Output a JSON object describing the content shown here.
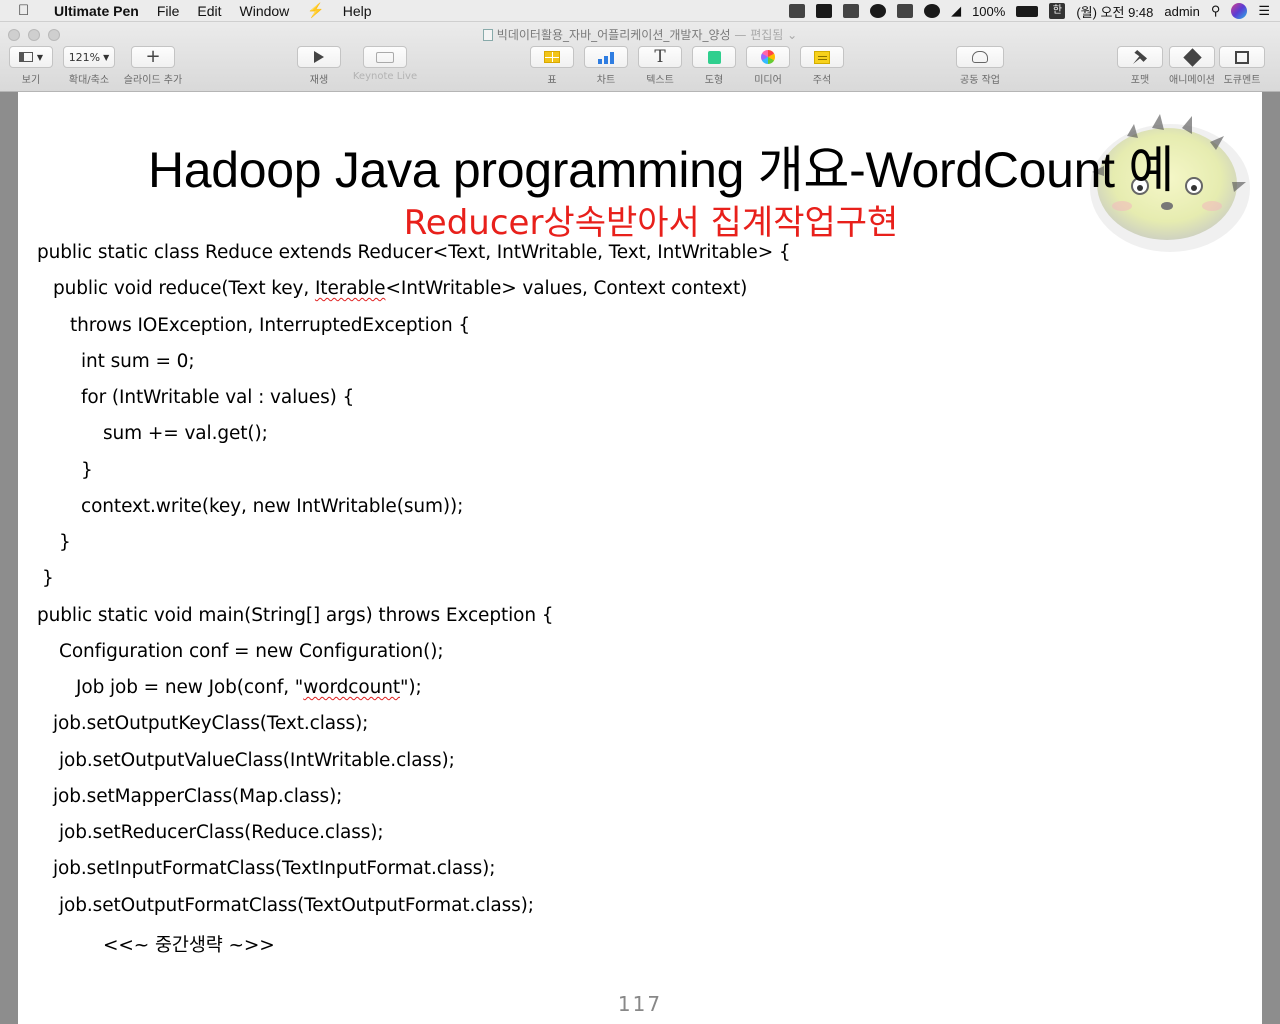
{
  "menubar": {
    "app_name": "Ultimate Pen",
    "menus": [
      "File",
      "Edit",
      "Window",
      "Help"
    ],
    "battery": "100%",
    "ime": "한",
    "clock": "(월) 오전 9:48",
    "user": "admin"
  },
  "window": {
    "title": "빅데이터활용_자바_어플리케이션_개발자_양성",
    "title_suffix": "— 편집됨 ⌄"
  },
  "toolbar": {
    "view_label": "보기",
    "zoom_value": "121%",
    "zoom_label": "확대/축소",
    "add_slide_label": "슬라이드 추가",
    "play_label": "재생",
    "keynote_live_label": "Keynote Live",
    "table_label": "표",
    "chart_label": "차트",
    "text_label": "텍스트",
    "shape_label": "도형",
    "media_label": "미디어",
    "comment_label": "주석",
    "collaborate_label": "공동 작업",
    "format_label": "포맷",
    "animate_label": "애니메이션",
    "document_label": "도큐멘트"
  },
  "slide": {
    "title": "Hadoop Java programming 개요-WordCount 예",
    "subtitle": "Reducer상속받아서 집계작업구현",
    "code": {
      "l1": "public static class Reduce extends Reducer<Text, IntWritable, Text, IntWritable> {",
      "l2_a": "public void reduce(Text key, ",
      "l2_b": "Iterable",
      "l2_c": "<IntWritable> values, Context context)",
      "l3": "throws IOException, InterruptedException {",
      "l4": "int sum = 0;",
      "l5": "for (IntWritable val : values) {",
      "l6": "sum += val.get();",
      "l7": "}",
      "l8": "context.write(key, new IntWritable(sum));",
      "l9": "}",
      "l10": "}",
      "l11": "public static void main(String[] args) throws Exception {",
      "l12": "Configuration conf = new Configuration();",
      "l13_a": "Job job = new Job(conf, \"",
      "l13_b": "wordcount",
      "l13_c": "\");",
      "l14": "job.setOutputKeyClass(Text.class);",
      "l15": "job.setOutputValueClass(IntWritable.class);",
      "l16": "job.setMapperClass(Map.class);",
      "l17": "job.setReducerClass(Reduce.class);",
      "l18": "job.setInputFormatClass(TextInputFormat.class);",
      "l19": "job.setOutputFormatClass(TextOutputFormat.class);",
      "l20": "<<~ 중간생략 ~>>"
    },
    "page_number": "117"
  }
}
